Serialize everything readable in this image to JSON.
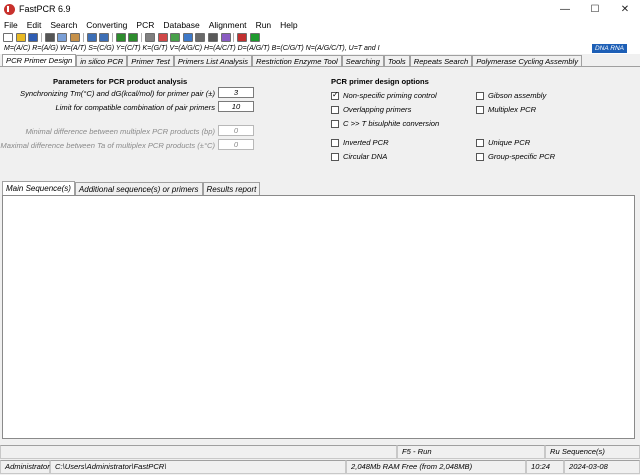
{
  "window": {
    "title": "FastPCR 6.9",
    "controls": [
      "—",
      "☐",
      "✕"
    ]
  },
  "menu": [
    "File",
    "Edit",
    "Search",
    "Converting",
    "PCR",
    "Database",
    "Alignment",
    "Run",
    "Help"
  ],
  "toolbar": {
    "buttons": [
      {
        "icon": "new-file-icon",
        "color": "#ffffff"
      },
      {
        "icon": "open-folder-icon",
        "color": "#e8b923"
      },
      {
        "icon": "save-icon",
        "color": "#2f5db3"
      },
      {
        "icon": "cut-icon",
        "color": "#555555"
      },
      {
        "icon": "copy-icon",
        "color": "#7a9fd6"
      },
      {
        "icon": "paste-icon",
        "color": "#c6914a"
      },
      {
        "icon": "find-icon",
        "color": "#3d6fb6"
      },
      {
        "icon": "find-next-icon",
        "color": "#3d6fb6"
      },
      {
        "icon": "undo-icon",
        "color": "#2d8c2d"
      },
      {
        "icon": "redo-icon",
        "color": "#2d8c2d"
      },
      {
        "icon": "sequence-icon",
        "color": "#7f7f7f"
      },
      {
        "icon": "chart-icon",
        "color": "#d04848"
      },
      {
        "icon": "image-icon",
        "color": "#48a04a"
      },
      {
        "icon": "report-icon",
        "color": "#3e79c8"
      },
      {
        "icon": "calculator-icon",
        "color": "#6a6a6a"
      },
      {
        "icon": "print-icon",
        "color": "#5a5a5a"
      },
      {
        "icon": "settings-icon",
        "color": "#8a5cc2"
      },
      {
        "icon": "primer-icon",
        "color": "#c23030"
      },
      {
        "icon": "run-icon",
        "color": "#1e9a2e"
      }
    ]
  },
  "iupac_line": "M=(A/C) R=(A/G) W=(A/T) S=(C/G) Y=(C/T) K=(G/T) V=(A/G/C) H=(A/C/T) D=(A/G/T) B=(C/G/T) N=(A/G/C/T), U=T and I",
  "dna_badge": "DNA RNA",
  "tabs": [
    "PCR Primer Design",
    "in silico PCR",
    "Primer Test",
    "Primers List Analysis",
    "Restriction Enzyme Tool",
    "Searching",
    "Tools",
    "Repeats Search",
    "Polymerase Cycling Assembly"
  ],
  "params": {
    "title": "Parameters for PCR product analysis",
    "fields": [
      {
        "label": "Synchronizing Tm(°C) and dG(kcal/mol) for primer pair (±)",
        "value": "3",
        "disabled": false
      },
      {
        "label": "Limit for compatible combination of pair primers",
        "value": "10",
        "disabled": false
      },
      {
        "label": "Minimal difference between multiplex PCR products (bp)",
        "value": "0",
        "disabled": true
      },
      {
        "label": "Maximal difference between Ta of multiplex PCR products (±°C)",
        "value": "0",
        "disabled": true
      }
    ]
  },
  "options": {
    "title": "PCR primer design options",
    "checks": [
      {
        "label": "Non-specific priming control",
        "checked": true
      },
      {
        "label": "Overlapping primers",
        "checked": false
      },
      {
        "label": "C >> T bisulphite conversion",
        "checked": false
      },
      {
        "label": "Inverted PCR",
        "checked": false
      },
      {
        "label": "Circular DNA",
        "checked": false
      },
      {
        "label": "Gibson assembly",
        "checked": false
      },
      {
        "label": "Multiplex PCR",
        "checked": false
      },
      {
        "label": "Unique PCR",
        "checked": false
      },
      {
        "label": "Group-specific PCR",
        "checked": false
      }
    ]
  },
  "seq_tabs": [
    "Main Sequence(s)",
    "Additional sequence(s) or primers",
    "Results report"
  ],
  "status": {
    "run_hint": "F5 - Run",
    "right_panel": "Ru Sequence(s)",
    "user": "Administrator",
    "path": "C:\\Users\\Administrator\\FastPCR\\",
    "ram": "2,048Mb RAM Free (from 2,048MB)",
    "time": "10:24",
    "date": "2024-03-08"
  }
}
